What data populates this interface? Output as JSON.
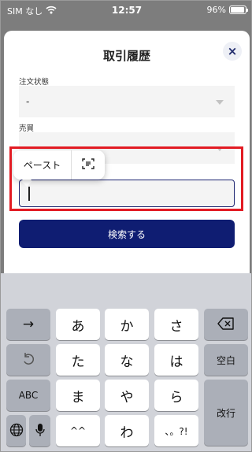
{
  "status_bar": {
    "carrier": "SIM なし",
    "time": "12:57",
    "battery": "96%",
    "battery_level": 0.96
  },
  "sheet": {
    "title": "取引履歴",
    "close_label": "×",
    "fields": [
      {
        "label": "注文状態",
        "value": "-"
      },
      {
        "label": "売買",
        "value": "-"
      }
    ],
    "input_value": "",
    "search_button": "検索する"
  },
  "paste_menu": {
    "paste_label": "ペースト"
  },
  "keyboard": {
    "row1": [
      "→",
      "あ",
      "か",
      "さ"
    ],
    "row2": [
      "た",
      "な",
      "は"
    ],
    "row3": [
      "ABC",
      "ま",
      "や",
      "ら"
    ],
    "row4": [
      "^^",
      "わ",
      "、。?!"
    ],
    "space_label": "空白",
    "return_label": "改行"
  },
  "colors": {
    "primary": "#0f1d72",
    "highlight": "#e21b23"
  }
}
